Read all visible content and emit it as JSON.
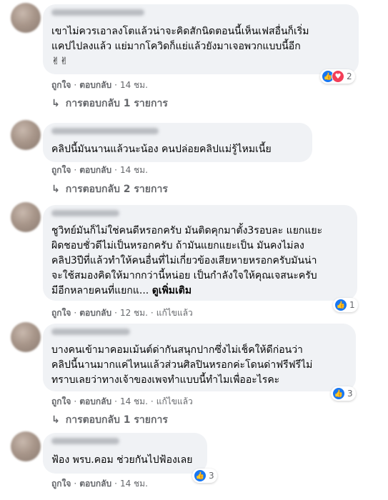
{
  "labels": {
    "like": "ถูกใจ",
    "reply": "ตอบกลับ",
    "edited": "แก้ไขแล้ว",
    "see_more": "ดูเพิ่มเติม"
  },
  "comments": [
    {
      "text": "เขาไม่ควรเอาลงโตแล้วน่าจะคิดสักนิดตอนนี้เห็นเฟสอื่นก็เริ่ม\nแคปไปลงแล้ว แย่มากโควิดก็แย่แล้วยังมาเจอพวกแบบนี้อีก\n✌✌",
      "time": "14 ชม.",
      "reactions": "2",
      "replies": "การตอบกลับ 1 รายการ"
    },
    {
      "text": "คลิปนี้มันนานแล้วนะน้อง คนปล่อยคลิปแม่รู้ไหมเนี้ย",
      "time": "14 ชม.",
      "replies": "การตอบกลับ 2 รายการ"
    },
    {
      "text": "ชูวิทย์มันก็ไม่ใช่คนดีหรอกครับ มันติดคุกมาตั้ง3รอบละ แยกแยะ\nผิดชอบชั่วดีไม่เป็นหรอกครับ ถ้ามันแยกแยะเป็น มันคงไม่ลง\nคลิป3ปีที่แล้วทำให้คนอื่นที่ไม่เกี่ยวข้องเสียหายหรอกครับมันน่า\nจะใช้สมองคิดให้มากกว่านี้หน่อย เป็นกำลังใจให้คุณเจสนะครับ\nมีอีกหลายคนที่แยกแ... ",
      "time": "12 ชม.",
      "reactions": "1"
    },
    {
      "text": "บางคนเข้ามาคอมเม้นต์ด่ากันสนุกปากซึ่งไม่เช็คให้ดีก่อนว่า\nคลิปนี้นานมากแค่ไหนแล้วส่วนศิลปินหรอกค่ะโดนด่าฟรีฟรีไม่\nทราบเลยว่าทางเจ้าของเพจทำแบบนี้ทำไมเพื่ออะไรคะ",
      "time": "14 ชม.",
      "reactions": "3",
      "replies": "การตอบกลับ 1 รายการ"
    },
    {
      "text": "ฟ้อง พรบ.คอม ช่วยกันไปฟ้องเลย",
      "time": "14 ชม.",
      "reactions": "3"
    }
  ]
}
